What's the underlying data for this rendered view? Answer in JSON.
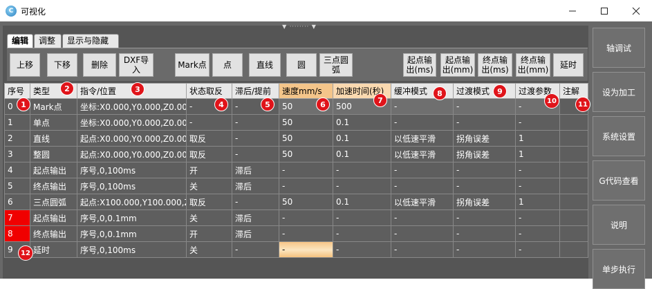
{
  "window": {
    "title": "可视化",
    "app_icon_text": "C"
  },
  "tabs": [
    "编辑",
    "调整",
    "显示与隐藏"
  ],
  "toolbar": {
    "buttons": [
      "上移",
      "下移",
      "删除",
      "DXF导\n入",
      "Mark点",
      "点",
      "直线",
      "圆",
      "三点圆\n弧",
      "起点输\n出(ms)",
      "起点输\n出(mm)",
      "终点输\n出(ms)",
      "终点输\n出(mm)",
      "延时"
    ]
  },
  "grid": {
    "headers": [
      "序号",
      "类型",
      "指令/位置",
      "状态取反",
      "滞后/提前",
      "速度mm/s",
      "加速时间(秒)",
      "缓冲模式",
      "过渡模式",
      "过渡参数",
      "注解"
    ],
    "rows": [
      [
        "0",
        "Mark点",
        "坐标:X0.000,Y0.000,Z0.000",
        "-",
        "-",
        "50",
        "500",
        "-",
        "-",
        "-",
        ""
      ],
      [
        "1",
        "单点",
        "坐标:X0.000,Y0.000,Z0.000",
        "-",
        "-",
        "50",
        "0.1",
        "-",
        "-",
        "-",
        ""
      ],
      [
        "2",
        "直线",
        "起点:X0.000,Y0.000,Z0.000",
        "取反",
        "-",
        "50",
        "0.1",
        "以低速平滑",
        "拐角误差",
        "1",
        ""
      ],
      [
        "3",
        "整圆",
        "起点:X0.000,Y0.000,Z0.000",
        "取反",
        "-",
        "50",
        "0.1",
        "以低速平滑",
        "拐角误差",
        "1",
        ""
      ],
      [
        "4",
        "起点输出",
        "序号,0,100ms",
        "开",
        "滞后",
        "-",
        "-",
        "-",
        "-",
        "-",
        ""
      ],
      [
        "5",
        "终点输出",
        "序号,0,100ms",
        "关",
        "滞后",
        "-",
        "-",
        "-",
        "-",
        "-",
        ""
      ],
      [
        "6",
        "三点圆弧",
        "起点:X100.000,Y100.000,Z0.000",
        "取反",
        "-",
        "50",
        "0.1",
        "以低速平滑",
        "拐角误差",
        "1",
        ""
      ],
      [
        "7",
        "起点输出",
        "序号,0,0.1mm",
        "关",
        "滞后",
        "-",
        "-",
        "-",
        "-",
        "-",
        ""
      ],
      [
        "8",
        "终点输出",
        "序号,0,0.1mm",
        "开",
        "滞后",
        "-",
        "-",
        "-",
        "-",
        "-",
        ""
      ],
      [
        "9",
        "延时",
        "序号,0,100ms",
        "关",
        "-",
        "-",
        "-",
        "-",
        "-",
        "-",
        ""
      ]
    ]
  },
  "badges": [
    "1",
    "2",
    "3",
    "4",
    "5",
    "6",
    "7",
    "8",
    "9",
    "10",
    "11",
    "12"
  ],
  "right_panel": {
    "buttons": [
      "轴调试",
      "设为加工",
      "系统设置",
      "G代码查看",
      "说明",
      "单步执行"
    ]
  },
  "colors": {
    "highlight_header": "#f4c58a",
    "marked_row": "#f00000",
    "badge": "#e0141a"
  }
}
